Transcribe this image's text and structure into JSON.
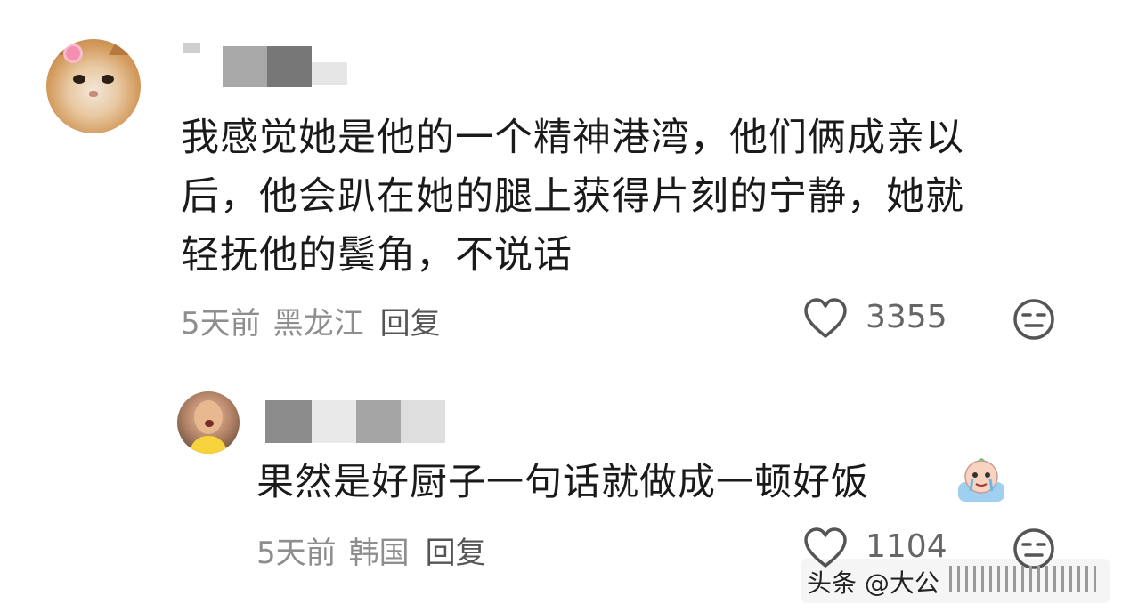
{
  "comment": {
    "lines": [
      "我感觉她是他的一个精神港湾，他们俩成亲以",
      "后，他会趴在她的腿上获得片刻的宁静，她就",
      "轻抚他的鬓角，不说话"
    ],
    "time": "5天前",
    "location": "黑龙江",
    "reply_label": "回复",
    "likes": "3355",
    "like_icon": "heart-icon",
    "extra_icon": "neutral-face-icon"
  },
  "reply": {
    "text": "果然是好厨子一句话就做成一顿好饭",
    "emoji_icon": "crying-sticker-icon",
    "time": "5天前",
    "location": "韩国",
    "reply_label": "回复",
    "likes": "1104",
    "like_icon": "heart-icon",
    "extra_icon": "neutral-face-icon"
  },
  "watermark": {
    "text": "头条 @大公"
  },
  "colors": {
    "text": "#1a1a1a",
    "meta": "#8e8e8e",
    "icon": "#555555"
  }
}
